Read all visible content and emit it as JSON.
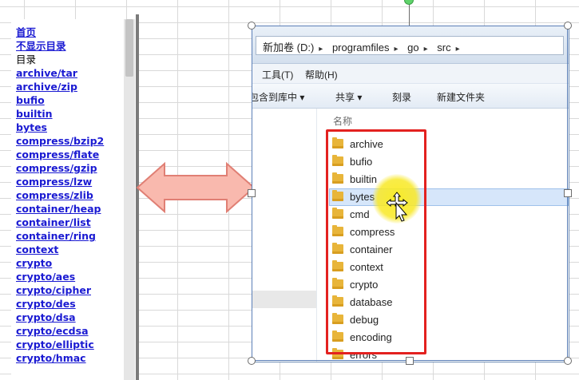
{
  "left_panel": {
    "items": [
      {
        "label": "首页",
        "kind": "link"
      },
      {
        "label": "不显示目录",
        "kind": "link"
      },
      {
        "label": "目录",
        "kind": "plain"
      },
      {
        "label": "archive/tar",
        "kind": "link"
      },
      {
        "label": "archive/zip",
        "kind": "link"
      },
      {
        "label": "bufio",
        "kind": "link"
      },
      {
        "label": "builtin",
        "kind": "link"
      },
      {
        "label": "bytes",
        "kind": "link"
      },
      {
        "label": "compress/bzip2",
        "kind": "link"
      },
      {
        "label": "compress/flate",
        "kind": "link"
      },
      {
        "label": "compress/gzip",
        "kind": "link"
      },
      {
        "label": "compress/lzw",
        "kind": "link"
      },
      {
        "label": "compress/zlib",
        "kind": "link"
      },
      {
        "label": "container/heap",
        "kind": "link"
      },
      {
        "label": "container/list",
        "kind": "link"
      },
      {
        "label": "container/ring",
        "kind": "link"
      },
      {
        "label": "context",
        "kind": "link"
      },
      {
        "label": "crypto",
        "kind": "link"
      },
      {
        "label": "crypto/aes",
        "kind": "link"
      },
      {
        "label": "crypto/cipher",
        "kind": "link"
      },
      {
        "label": "crypto/des",
        "kind": "link"
      },
      {
        "label": "crypto/dsa",
        "kind": "link"
      },
      {
        "label": "crypto/ecdsa",
        "kind": "link"
      },
      {
        "label": "crypto/elliptic",
        "kind": "link"
      },
      {
        "label": "crypto/hmac",
        "kind": "link"
      }
    ]
  },
  "explorer": {
    "address": [
      "新加卷 (D:)",
      "programfiles",
      "go",
      "src"
    ],
    "address_separator": "▸",
    "menu": {
      "tools": "工具(T)",
      "help": "帮助(H)"
    },
    "toolbar": {
      "include": "包含到库中 ▾",
      "share": "共享 ▾",
      "burn": "刻录",
      "new_folder": "新建文件夹"
    },
    "column_header": "名称",
    "folders": [
      "archive",
      "bufio",
      "builtin",
      "bytes",
      "cmd",
      "compress",
      "container",
      "context",
      "crypto",
      "database",
      "debug",
      "encoding",
      "errors"
    ],
    "selected_folder": "bytes"
  },
  "colors": {
    "link": "#1a1ad2",
    "highlight_box": "#e3211f",
    "cursor_glow": "#f8e828",
    "arrow_fill": "#f9b9ae",
    "arrow_stroke": "#e07f74"
  },
  "icons": [
    "folder-icon",
    "double-arrow-icon",
    "move-cursor-icon"
  ]
}
